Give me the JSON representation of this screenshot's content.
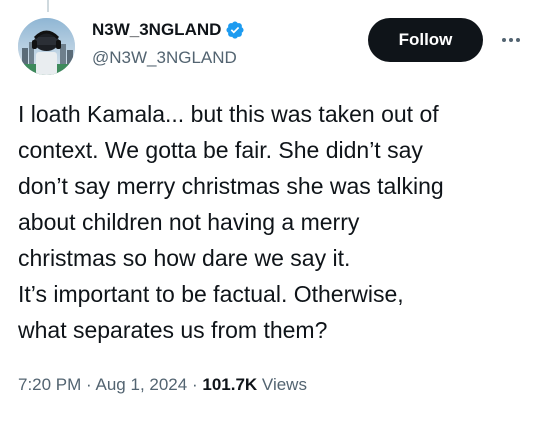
{
  "author": {
    "display_name": "N3W_3NGLAND",
    "handle": "@N3W_3NGLAND",
    "verified": true,
    "verified_color": "#1d9bf0"
  },
  "actions": {
    "follow_label": "Follow",
    "more_icon": "more-horizontal-icon"
  },
  "tweet": {
    "lines": [
      "I loath Kamala... but this was taken out of",
      "context. We gotta be fair. She didn’t say",
      "don’t say merry christmas she was talking",
      "about children not having a merry",
      "christmas so how dare we say it.",
      "It’s important to be factual. Otherwise,",
      "what separates us from them?"
    ],
    "time": "7:20 PM",
    "date": "Aug 1, 2024",
    "separator": "·",
    "views_count": "101.7K",
    "views_label": "Views"
  }
}
